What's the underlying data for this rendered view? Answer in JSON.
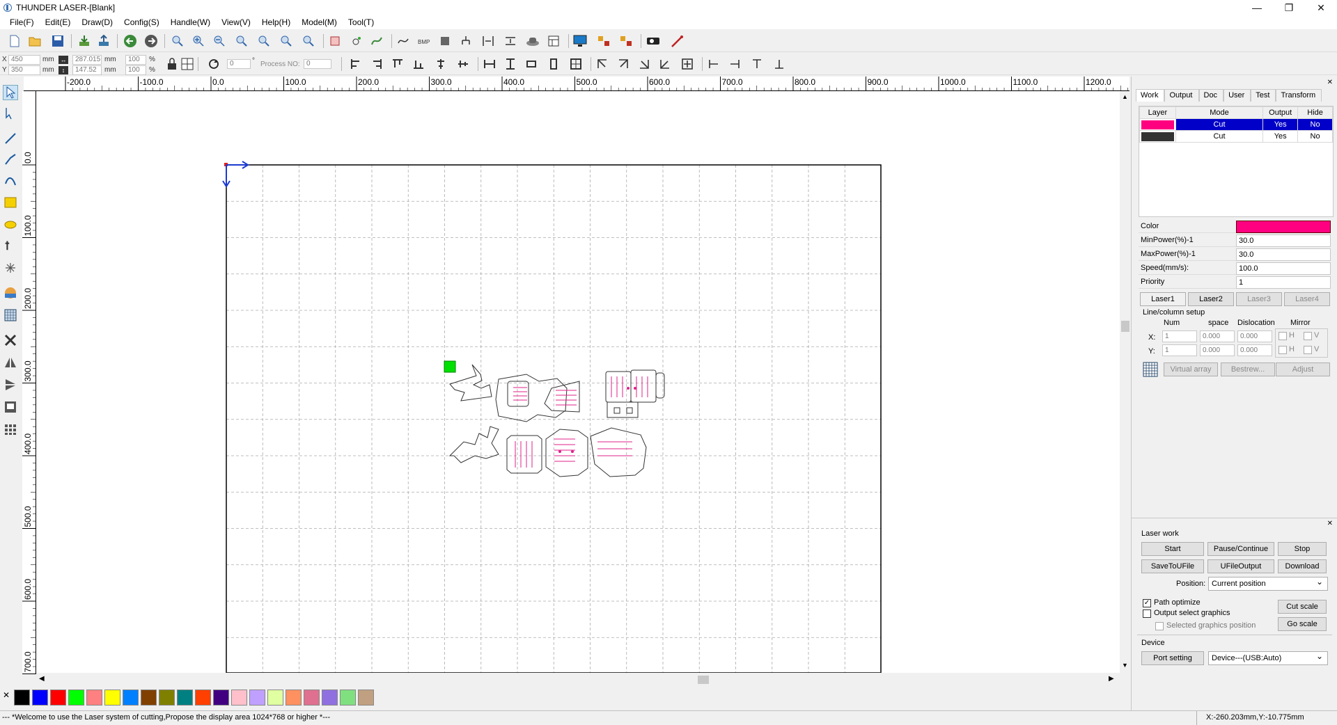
{
  "window": {
    "title": "THUNDER LASER-[Blank]",
    "min": "—",
    "max": "❐",
    "close": "✕"
  },
  "menu": [
    "File(F)",
    "Edit(E)",
    "Draw(D)",
    "Config(S)",
    "Handle(W)",
    "View(V)",
    "Help(H)",
    "Model(M)",
    "Tool(T)"
  ],
  "coords": {
    "x_label": "X",
    "x_value": "450",
    "y_label": "Y",
    "y_value": "350",
    "unit": "mm",
    "w_value": "287.015",
    "h_value": "147.52",
    "w_pct": "100",
    "h_pct": "100",
    "pct": "%",
    "rotate_value": "0",
    "degree": "°",
    "process_label": "Process NO:",
    "process_value": "0"
  },
  "ruler_h": [
    "-200.0",
    "-100.0",
    "0.0",
    "100.0",
    "200.0",
    "300.0",
    "400.0",
    "500.0",
    "600.0",
    "700.0",
    "800.0",
    "900.0",
    "1000.0",
    "1100.0",
    "1200.0"
  ],
  "ruler_v": [
    "0.0",
    "100.0",
    "200.0",
    "300.0",
    "400.0",
    "500.0",
    "600.0",
    "700.0"
  ],
  "palette": [
    "#000000",
    "#0000ff",
    "#ff0000",
    "#00ff00",
    "#ff8080",
    "#ffff00",
    "#0080ff",
    "#804000",
    "#808000",
    "#008080",
    "#ff4000",
    "#400080",
    "#ffc0cb",
    "#c0a0ff",
    "#e0ffa0",
    "#ff9060",
    "#e07090",
    "#9070e0",
    "#80e080",
    "#c0a080"
  ],
  "status": {
    "message": "--- *Welcome to use the Laser system of cutting,Propose the display area 1024*768 or higher *---",
    "cursor": "X:-260.203mm,Y:-10.775mm"
  },
  "panel": {
    "tabs": [
      "Work",
      "Output",
      "Doc",
      "User",
      "Test",
      "Transform"
    ],
    "layer_headers": [
      "Layer",
      "Mode",
      "Output",
      "Hide"
    ],
    "layers": [
      {
        "color": "#ff0080",
        "mode": "Cut",
        "output": "Yes",
        "hide": "No"
      },
      {
        "color": "#333333",
        "mode": "Cut",
        "output": "Yes",
        "hide": "No"
      }
    ],
    "props": [
      {
        "k": "Color",
        "v": ""
      },
      {
        "k": "MinPower(%)-1",
        "v": "30.0"
      },
      {
        "k": "MaxPower(%)-1",
        "v": "30.0"
      },
      {
        "k": "Speed(mm/s):",
        "v": "100.0"
      },
      {
        "k": "Priority",
        "v": "1"
      }
    ],
    "laser_tabs": [
      "Laser1",
      "Laser2",
      "Laser3",
      "Laser4"
    ],
    "linecol": {
      "title": "Line/column setup",
      "num": "Num",
      "space": "space",
      "dislocation": "Dislocation",
      "mirror": "Mirror",
      "x": "X:",
      "y": "Y:",
      "x_num": "1",
      "x_space": "0.000",
      "x_dis": "0.000",
      "y_num": "1",
      "y_space": "0.000",
      "y_dis": "0.000",
      "h": "H",
      "v": "V"
    },
    "array_buttons": [
      "Virtual array",
      "Bestrew...",
      "Adjust"
    ],
    "laserwork": {
      "title": "Laser work",
      "start": "Start",
      "pause": "Pause/Continue",
      "stop": "Stop",
      "save": "SaveToUFile",
      "ufile": "UFileOutput",
      "download": "Download",
      "position_label": "Position:",
      "position": "Current position",
      "path_opt": "Path optimize",
      "output_sel": "Output select graphics",
      "selected_pos": "Selected graphics position",
      "cut_scale": "Cut scale",
      "go_scale": "Go scale"
    },
    "device": {
      "title": "Device",
      "port": "Port setting",
      "device": "Device---(USB:Auto)"
    }
  }
}
